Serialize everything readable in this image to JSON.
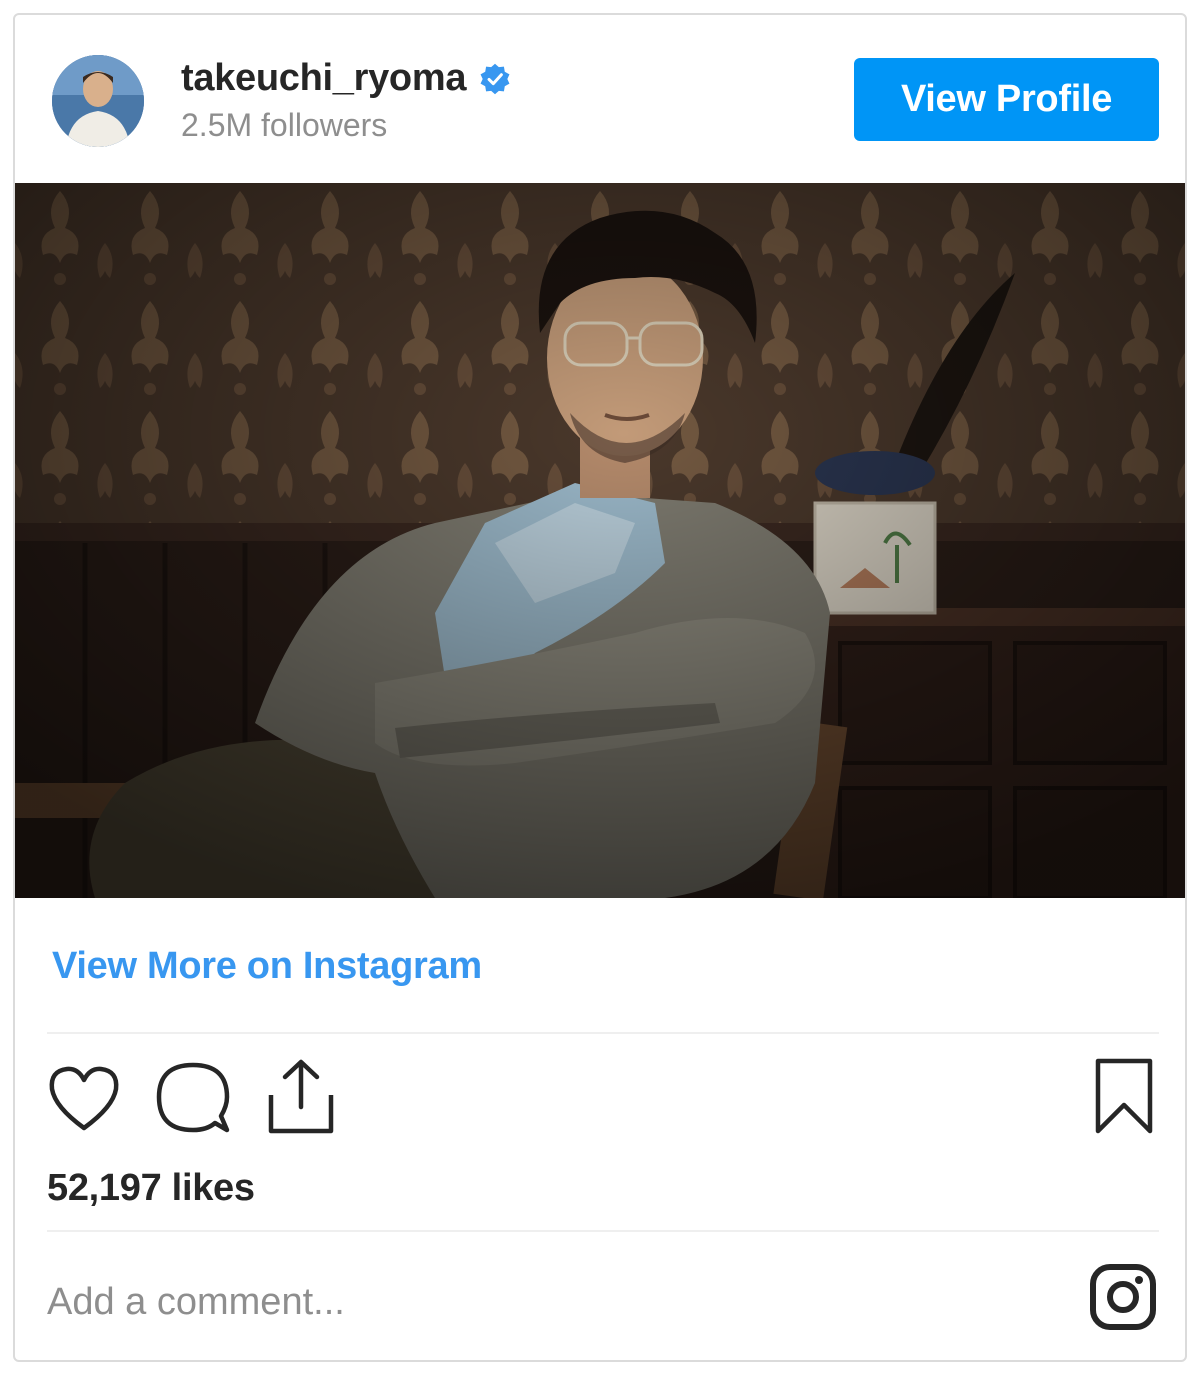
{
  "header": {
    "username": "takeuchi_ryoma",
    "followers": "2.5M followers",
    "view_profile_label": "View Profile",
    "avatar_icon": "profile-avatar",
    "verified_icon": "verified-badge-icon"
  },
  "post": {
    "view_more_label": "View More on Instagram"
  },
  "actions": {
    "icons": [
      "heart-icon",
      "comment-icon",
      "share-icon",
      "bookmark-icon"
    ]
  },
  "likes_text": "52,197 likes",
  "comment": {
    "placeholder": "Add a comment..."
  },
  "footer": {
    "logo_icon": "instagram-icon"
  },
  "colors": {
    "accent": "#0095f6",
    "link": "#3897f0",
    "text": "#262626",
    "muted": "#8e8e8e",
    "border": "#dbdbdb"
  }
}
